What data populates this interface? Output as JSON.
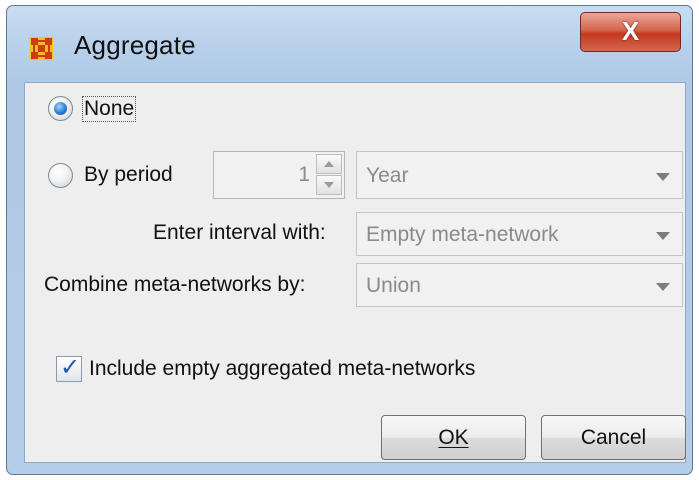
{
  "window": {
    "title": "Aggregate",
    "close_label": "X"
  },
  "options": {
    "none_label": "None",
    "by_period_label": "By period",
    "period_count": "1",
    "period_unit": "Year",
    "enter_interval_label": "Enter interval with:",
    "enter_interval_value": "Empty meta-network",
    "combine_label": "Combine meta-networks by:",
    "combine_value": "Union",
    "include_empty_label": "Include empty aggregated meta-networks",
    "include_empty_checked": true,
    "selected_radio": "None"
  },
  "buttons": {
    "ok_label": "OK",
    "cancel_label": "Cancel"
  },
  "colors": {
    "frame": "#b8d0ea",
    "close_button": "#c4381f",
    "content_bg": "#eeeeee",
    "radio_selected": "#2d7fd0",
    "app_icon": "#d23a12"
  },
  "icons": {
    "app": "network-grid-icon",
    "close": "close-icon",
    "spinner_up": "arrow-up-icon",
    "spinner_down": "arrow-down-icon",
    "dropdown": "chevron-down-icon",
    "checkbox": "checkmark-icon"
  }
}
